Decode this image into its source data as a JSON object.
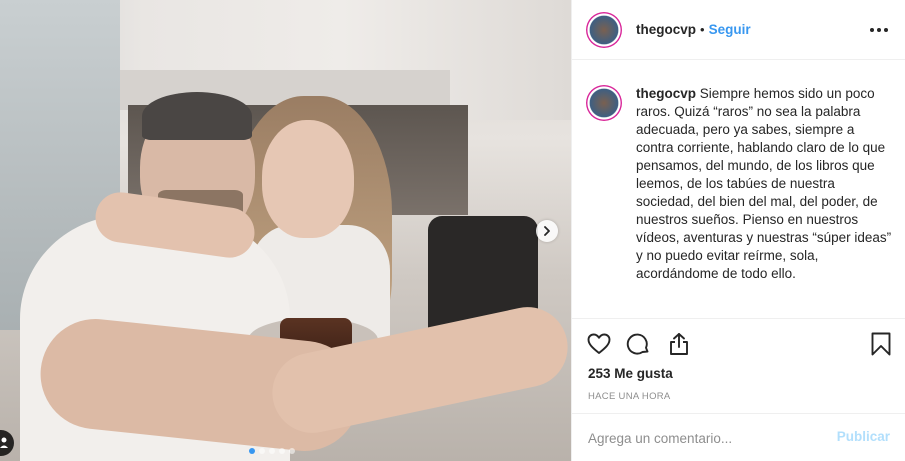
{
  "post": {
    "username": "thegocvp",
    "separator": "•",
    "follow_label": "Seguir",
    "more_icon": "more-horizontal-icon",
    "caption_username": "thegocvp",
    "caption_text": "Siempre hemos sido un poco raros. Quizá “raros” no sea la palabra adecuada, pero ya sabes, siempre a contra corriente, hablando claro de lo que pensamos, del mundo, de los libros que leemos, de los tabúes de nuestra sociedad, del bien del mal, del poder, de nuestros sueños. Pienso en nuestros vídeos, aventuras y nuestras “súper ideas” y no puedo evitar reírme, sola, acordándome de todo ello.",
    "likes_label": "253 Me gusta",
    "timestamp": "HACE UNA HORA",
    "comment_placeholder": "Agrega un comentario...",
    "publish_label": "Publicar"
  },
  "carousel": {
    "slide_count": 5,
    "active_index": 0
  },
  "colors": {
    "accent": "#3897f0",
    "publish_disabled": "#b2dffc",
    "muted_text": "#8e8e8e",
    "divider": "#efefef"
  },
  "icons": [
    "heart-icon",
    "comment-icon",
    "share-icon",
    "bookmark-icon",
    "chevron-right-icon",
    "user-tag-icon"
  ]
}
